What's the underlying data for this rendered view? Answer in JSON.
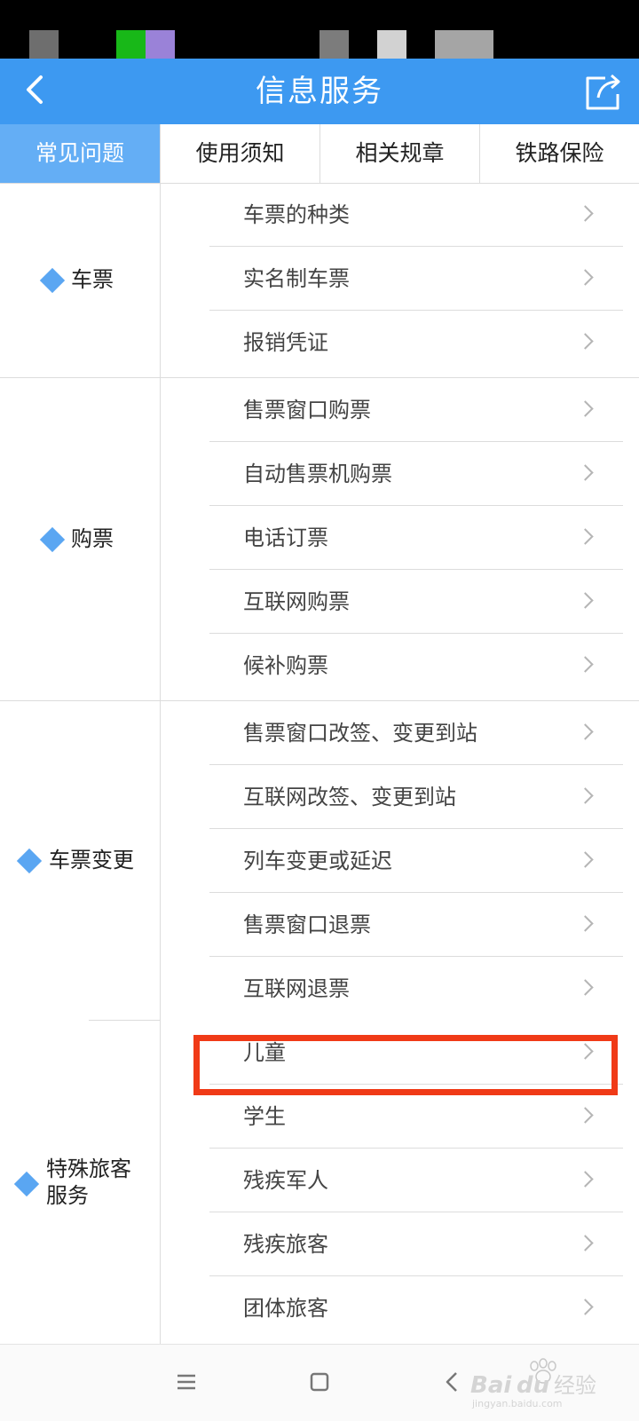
{
  "header": {
    "title": "信息服务",
    "back_icon": "back-chevron-icon",
    "share_icon": "share-icon"
  },
  "tabs": [
    {
      "label": "常见问题",
      "active": true
    },
    {
      "label": "使用须知",
      "active": false
    },
    {
      "label": "相关规章",
      "active": false
    },
    {
      "label": "铁路保险",
      "active": false
    }
  ],
  "categories": [
    {
      "label": "车票",
      "items": [
        "车票的种类",
        "实名制车票",
        "报销凭证"
      ]
    },
    {
      "label": "购票",
      "items": [
        "售票窗口购票",
        "自动售票机购票",
        "电话订票",
        "互联网购票",
        "候补购票"
      ]
    },
    {
      "label": "车票变更",
      "items": [
        "售票窗口改签、变更到站",
        "互联网改签、变更到站",
        "列车变更或延迟",
        "售票窗口退票",
        "互联网退票"
      ]
    },
    {
      "label_lines": [
        "特殊旅客",
        "服务"
      ],
      "items": [
        "儿童",
        "学生",
        "残疾军人",
        "残疾旅客",
        "团体旅客"
      ]
    }
  ],
  "highlighted_item": "儿童",
  "colors": {
    "accent": "#3d99f1",
    "active_tab": "#64aef5",
    "highlight": "#f03a17",
    "diamond": "#5aa6f2"
  },
  "navbar": {
    "menu_icon": "menu-icon",
    "home_icon": "home-square-icon",
    "back_icon": "nav-back-icon"
  },
  "watermark": {
    "brand": "Bai",
    "brand2": "du",
    "suffix": "经验",
    "url": "jingyan.baidu.com"
  }
}
